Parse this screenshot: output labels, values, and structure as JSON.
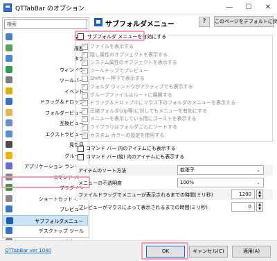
{
  "window": {
    "title": "QTTabBar のオプション",
    "minimize": "—",
    "maximize": "☐",
    "close": "✕"
  },
  "search": {
    "placeholder": "検索"
  },
  "sidebar": {
    "items": [
      {
        "label": "全般",
        "icon": "settings-icon",
        "color": "#4a7fc1"
      },
      {
        "label": "履歴",
        "icon": "history-icon",
        "color": "#5aa05a"
      },
      {
        "label": "タブ",
        "icon": "tab-icon",
        "color": "#4a86d4"
      },
      {
        "label": "ウィンドウ",
        "icon": "window-icon",
        "color": "#2f9a53"
      },
      {
        "label": "ツールバー",
        "icon": "toolbar-icon",
        "color": "#7b7b7b"
      },
      {
        "label": "イベント",
        "icon": "lightning-icon",
        "color": "#e0b000"
      },
      {
        "label": "ドラッグ＆ドロップ",
        "icon": "drag-drop-icon",
        "color": "#3a6fc9"
      },
      {
        "label": "フォルダービュー",
        "icon": "folder-view-icon",
        "color": "#e4b84a"
      },
      {
        "label": "互換ビュー",
        "icon": "compat-view-icon",
        "color": "#6a8fc8"
      },
      {
        "label": "エクストラビュー",
        "icon": "extra-view-icon",
        "color": "#5c8fd0"
      },
      {
        "label": "見た目",
        "icon": "eye-icon",
        "color": "#4c4c4c"
      },
      {
        "label": "グループ",
        "icon": "star-icon",
        "color": "#f0b400"
      },
      {
        "label": "アプリケーション ランチャ",
        "icon": "launcher-icon",
        "color": "#6b6bd6"
      },
      {
        "label": "コマンド バー",
        "icon": "command-bar-icon",
        "color": "#888888"
      },
      {
        "label": "プラグイン",
        "icon": "plugin-icon",
        "color": "#3c9a3c"
      },
      {
        "label": "ショートカット キー",
        "icon": "keyboard-icon",
        "color": "#888888"
      },
      {
        "label": "プレビュー",
        "icon": "preview-icon",
        "color": "#3a78c4"
      },
      {
        "label": "サブフォルダメニュー",
        "icon": "subfolder-menu-icon",
        "color": "#1b5eb8",
        "selected": true
      },
      {
        "label": "デスクトップ ツール",
        "icon": "desktop-tool-icon",
        "color": "#2f6fd1"
      },
      {
        "label": "サウンド",
        "icon": "sound-icon",
        "color": "#888888"
      },
      {
        "label": "その他",
        "icon": "misc-icon",
        "color": "#888888"
      }
    ]
  },
  "panel": {
    "title": "サブフォルダメニュー",
    "help_label": "?",
    "default_button": "このページをデフォルトに戻す",
    "enable_option": "サブフォルダ メニューを有効にする",
    "sub_options": [
      {
        "label": "ファイルを表示する",
        "checked": true
      },
      {
        "label": "隠し属性のオブジェクトを表示する",
        "checked": true
      },
      {
        "label": "システム属性のオブジェクトを表示する",
        "checked": true
      },
      {
        "label": "ツールチップでプレビュー",
        "checked": true
      },
      {
        "label": "Shiftキー押下で表示する",
        "checked": false
      },
      {
        "label": "フォルダ ウィンドウがアクティブでも表示する",
        "checked": true
      },
      {
        "label": "グループファイルはルートに展開する",
        "checked": true
      },
      {
        "label": "ドラッグ＆ドロップ中にマウス下のフォルダのメニューを表示する",
        "checked": true
      },
      {
        "label": "圧縮フォルダ(zip等)に対してもメニューを有効にする",
        "checked": true
      },
      {
        "label": "メニューを表示している間にゴーストを表示する",
        "checked": true
      },
      {
        "label": "ライブラリはフォルダごとにソートする",
        "checked": true
      },
      {
        "label": "カスタム カラーの設定を使用する",
        "checked": true
      }
    ],
    "commandbar_options": [
      {
        "label": "コマンド バー 内のアイテムにも表示する",
        "checked": false
      },
      {
        "label": "コマンド バー(縦) 内のアイテムにも表示する",
        "checked": false
      }
    ],
    "settings": [
      {
        "label": "アイテムのソート方法",
        "type": "select",
        "value": "拡張子"
      },
      {
        "label": "メニューの不透明度",
        "type": "select",
        "value": "100%"
      },
      {
        "label": "ファイルドラッグでメニューが表示されるまでの時間(ミリ秒)",
        "type": "number",
        "value": "1200"
      },
      {
        "label": "プレビューがマウスによって表示されるまでの時間(ミリ秒)",
        "type": "number",
        "value": "0"
      }
    ]
  },
  "footer": {
    "version_link": "QTTabBar ver 1040",
    "ok": "OK",
    "cancel": "キャンセル(C)",
    "apply": "適用(A)"
  }
}
